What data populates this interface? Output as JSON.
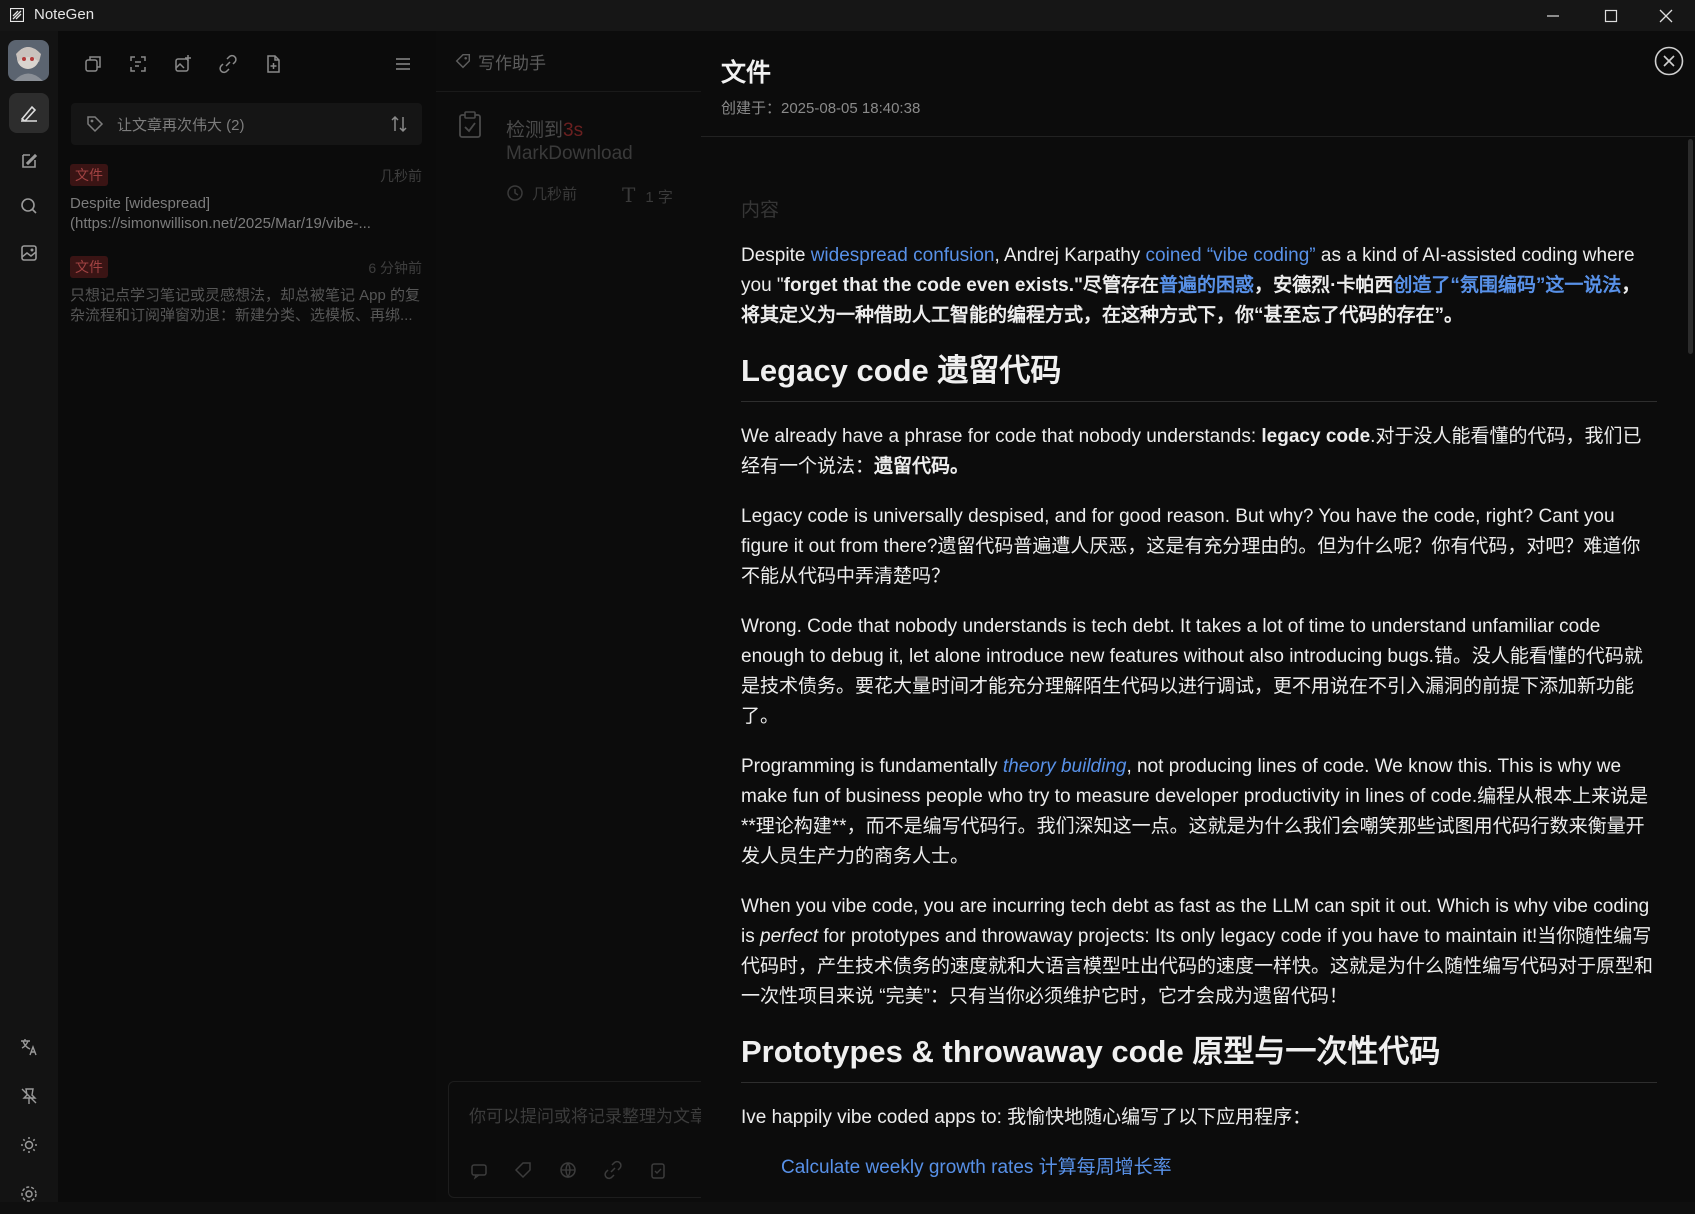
{
  "app": {
    "title": "NoteGen"
  },
  "notes_panel": {
    "tag_select": {
      "label": "让文章再次伟大 (2)"
    },
    "items": [
      {
        "badge": "文件",
        "time": "几秒前",
        "line1": "Despite [widespread]",
        "line2": "(https://simonwillison.net/2025/Mar/19/vibe-..."
      },
      {
        "badge": "文件",
        "time": "6 分钟前",
        "line1": "只想记点学习笔记或灵感想法，却总被笔记 App 的复",
        "line2": "杂流程和订阅弹窗劝退：新建分类、选模板、再绑..."
      }
    ]
  },
  "record_panel": {
    "header": "写作助手",
    "record": {
      "title": "检测到",
      "title_highlight": "3s",
      "subtitle": "MarkDownload",
      "time": "几秒前",
      "count": "1 字"
    },
    "chat_placeholder": "你可以提问或将记录整理为文章"
  },
  "detail": {
    "title": "文件",
    "created": "创建于：2025-08-05 18:40:38",
    "category": "内容",
    "p1": {
      "a": "Despite ",
      "link1": "widespread confusion",
      "b": ", Andrej Karpathy ",
      "link2": "coined “vibe coding”",
      "c": " as a kind of AI-assisted coding where you \"",
      "bold1": "forget that the code even exists.\"尽管存在",
      "link3": "普遍的困惑",
      "bold2": "，安德烈·卡帕西",
      "link4": "创造了“氛围编码”这一说法",
      "bold3": "，将其定义为一种借助人工智能的编程方式，在这种方式下，你“甚至忘了代码的存在”。"
    },
    "h2_1": "Legacy code 遗留代码",
    "p2": {
      "a": "We already have a phrase for code that nobody understands: ",
      "b1": "legacy code",
      "c": ".对于没人能看懂的代码，我们已经有一个说法：",
      "b2": "遗留代码。"
    },
    "p3": "Legacy code is universally despised, and for good reason. But why? You have the code, right? Cant you figure it out from there?遗留代码普遍遭人厌恶，这是有充分理由的。但为什么呢？你有代码，对吧？难道你不能从代码中弄清楚吗？",
    "p4": "Wrong. Code that nobody understands is tech debt. It takes a lot of time to understand unfamiliar code enough to debug it, let alone introduce new features without also introducing bugs.错。没人能看懂的代码就是技术债务。要花大量时间才能充分理解陌生代码以进行调试，更不用说在不引入漏洞的前提下添加新功能了。",
    "p5": {
      "a": "Programming is fundamentally ",
      "link": "theory building",
      "b": ", not producing lines of code. We know this. This is why we make fun of business people who try to measure developer productivity in lines of code.编程从根本上来说是**理论构建**，而不是编写代码行。我们深知这一点。这就是为什么我们会嘲笑那些试图用代码行数来衡量开发人员生产力的商务人士。"
    },
    "p6": {
      "a": "When you vibe code, you are incurring tech debt as fast as the LLM can spit it out. Which is why vibe coding is ",
      "em": "perfect",
      "b": " for prototypes and throwaway projects: Its only legacy code if you have to maintain it!当你随性编写代码时，产生技术债务的速度就和大语言模型吐出代码的速度一样快。这就是为什么随性编写代码对于原型和一次性项目来说 “完美”：只有当你必须维护它时，它才会成为遗留代码！"
    },
    "h2_2": "Prototypes & throwaway code 原型与一次性代码",
    "p7": "Ive happily vibe coded apps to: 我愉快地随心编写了以下应用程序：",
    "li1": "Calculate weekly growth rates 计算每周增长率"
  }
}
